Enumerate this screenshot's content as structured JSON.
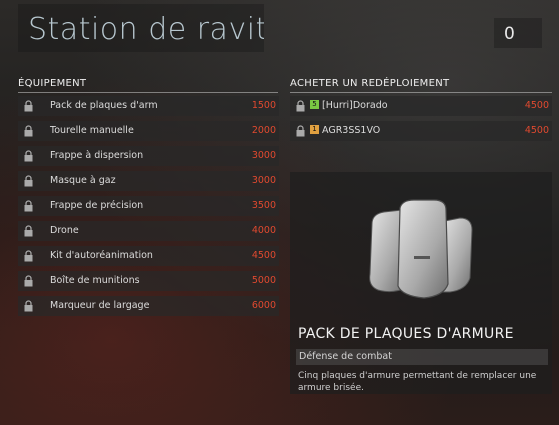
{
  "header": {
    "title": "Station de ravitaillement",
    "counter": "0"
  },
  "equipment": {
    "heading": "ÉQUIPEMENT",
    "items": [
      {
        "label": "Pack de plaques d'arm",
        "price": "1500"
      },
      {
        "label": "Tourelle manuelle",
        "price": "2000"
      },
      {
        "label": "Frappe à dispersion",
        "price": "3000"
      },
      {
        "label": "Masque à gaz",
        "price": "3000"
      },
      {
        "label": "Frappe de précision",
        "price": "3500"
      },
      {
        "label": "Drone",
        "price": "4000"
      },
      {
        "label": "Kit d'autoréanimation",
        "price": "4500"
      },
      {
        "label": "Boîte de munitions",
        "price": "5000"
      },
      {
        "label": "Marqueur de largage",
        "price": "6000"
      }
    ]
  },
  "redeploy": {
    "heading": "ACHETER UN REDÉPLOIEMENT",
    "players": [
      {
        "badge": "5",
        "badge_color": "#7ac943",
        "name": "[Hurri]Dorado",
        "price": "4500"
      },
      {
        "badge": "1",
        "badge_color": "#e0a040",
        "name": "AGR3SS1VO",
        "price": "4500"
      }
    ]
  },
  "detail": {
    "title": "PACK DE PLAQUES D'ARMURE",
    "category": "Défense de combat",
    "description": "Cinq plaques d'armure permettant de remplacer une armure brisée."
  },
  "colors": {
    "price": "#e0492f",
    "title": "#b7c7cf"
  },
  "icons": {
    "lock": "lock-icon",
    "item": "armor-plates-image"
  }
}
